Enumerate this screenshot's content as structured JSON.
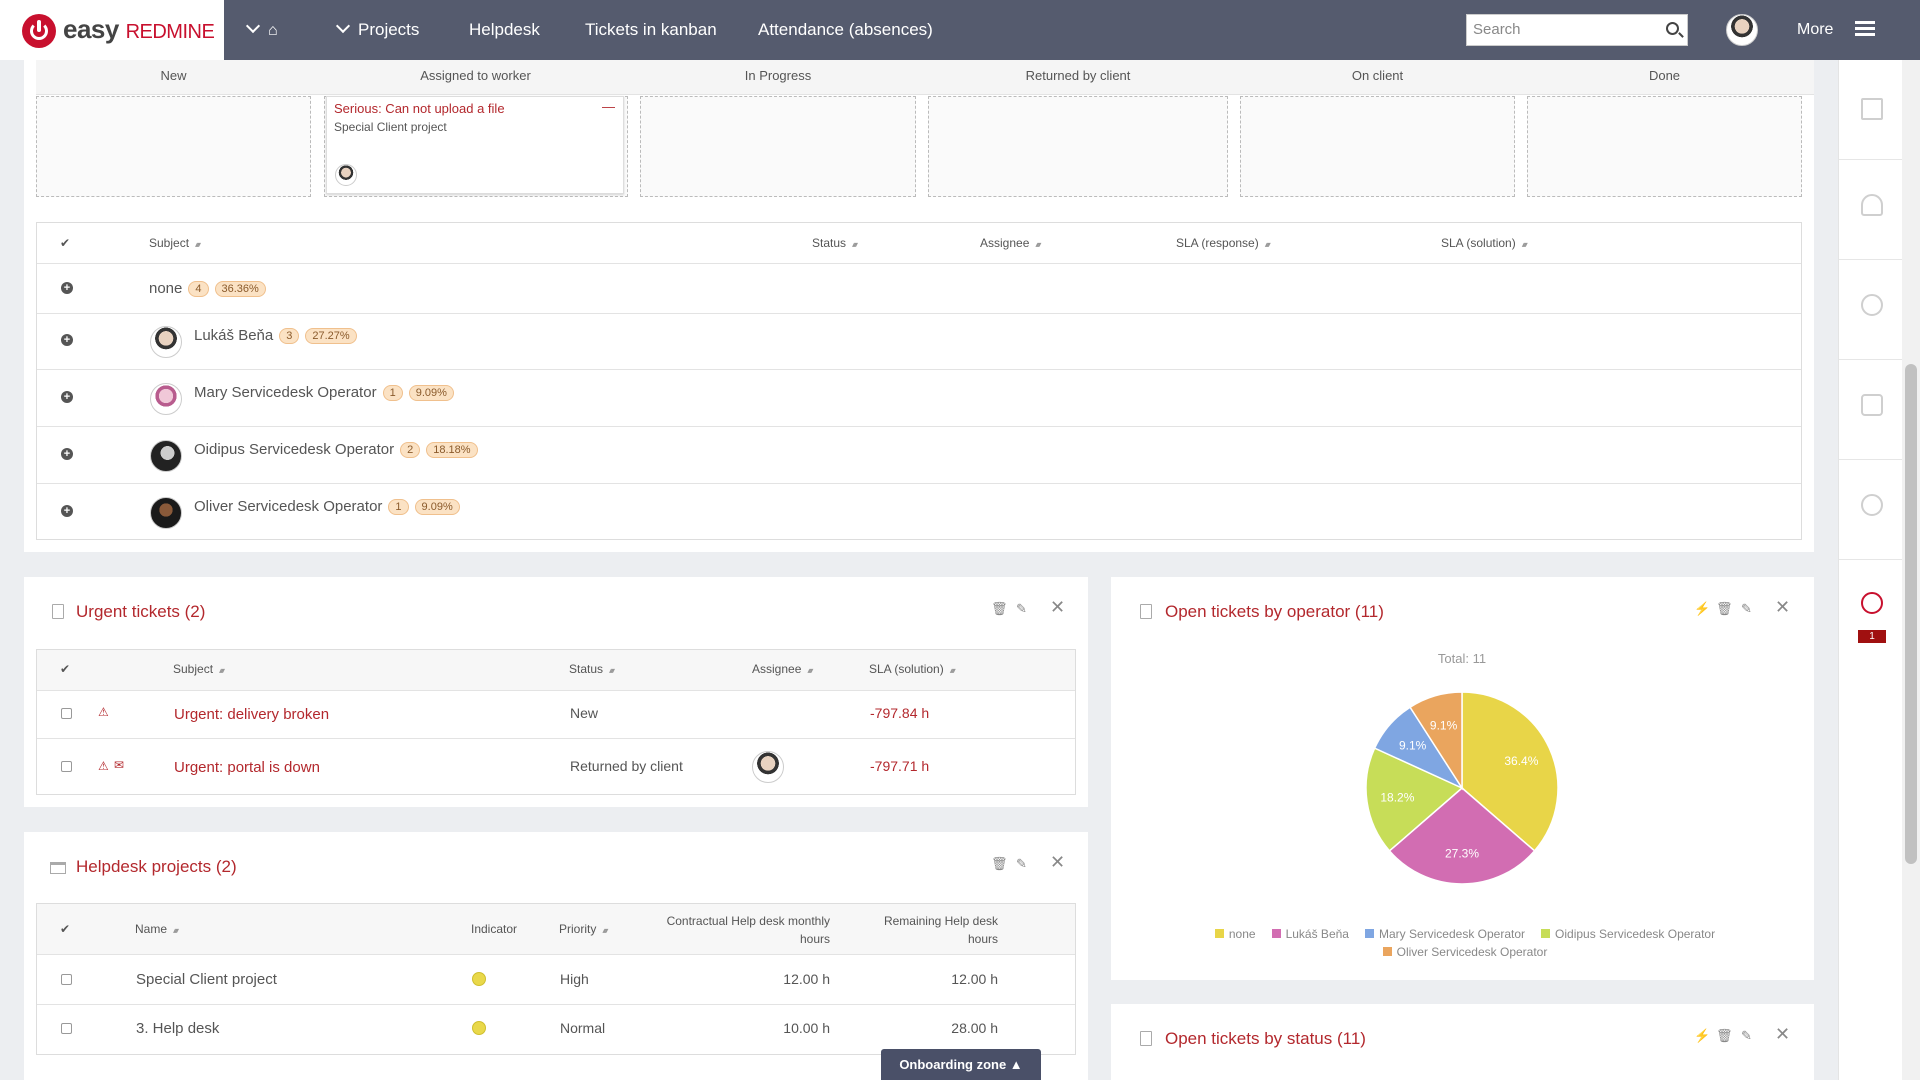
{
  "header": {
    "logo_brand": "easy",
    "logo_product": "REDMINE",
    "nav": [
      "Projects",
      "Helpdesk",
      "Tickets in kanban",
      "Attendance (absences)"
    ],
    "search_placeholder": "Search",
    "more": "More"
  },
  "kanban": {
    "columns": [
      "New",
      "Assigned to worker",
      "In Progress",
      "Returned by client",
      "On client",
      "Done"
    ],
    "card": {
      "title": "Serious: Can not upload a file",
      "project": "Special Client project",
      "collapse": "—"
    }
  },
  "grouped": {
    "headers": [
      "Subject",
      "Status",
      "Assignee",
      "SLA (response)",
      "SLA (solution)"
    ],
    "check": "✔",
    "groups": [
      {
        "label": "none",
        "count": "4",
        "pct": "36.36%"
      },
      {
        "label": "Lukáš Beňa",
        "count": "3",
        "pct": "27.27%"
      },
      {
        "label": "Mary Servicedesk Operator",
        "count": "1",
        "pct": "9.09%"
      },
      {
        "label": "Oidipus Servicedesk Operator",
        "count": "2",
        "pct": "18.18%"
      },
      {
        "label": "Oliver Servicedesk Operator",
        "count": "1",
        "pct": "9.09%"
      }
    ]
  },
  "urgent": {
    "title": "Urgent tickets (2)",
    "headers": [
      "Subject",
      "Status",
      "Assignee",
      "SLA (solution)"
    ],
    "rows": [
      {
        "subject": "Urgent: delivery broken",
        "status": "New",
        "sla": "-797.84 h"
      },
      {
        "subject": "Urgent: portal is down",
        "status": "Returned by client",
        "sla": "-797.71 h"
      }
    ]
  },
  "projects": {
    "title": "Helpdesk projects (2)",
    "headers": {
      "name": "Name",
      "indicator": "Indicator",
      "priority": "Priority",
      "contract_1": "Contractual Help desk monthly",
      "contract_2": "hours",
      "remaining_1": "Remaining Help desk",
      "remaining_2": "hours"
    },
    "rows": [
      {
        "name": "Special Client project",
        "priority": "High",
        "contract": "12.00 h",
        "remaining": "12.00 h"
      },
      {
        "name": "3. Help desk",
        "priority": "Normal",
        "contract": "10.00 h",
        "remaining": "28.00 h"
      }
    ]
  },
  "operator_chart": {
    "title": "Open tickets by operator (11)"
  },
  "status_chart": {
    "title": "Open tickets by status (11)"
  },
  "onboarding": "Onboarding zone ▲",
  "sidebar_badge": "1",
  "chart_data": {
    "type": "pie",
    "title": "Total: 11",
    "categories": [
      "none",
      "Lukáš Beňa",
      "Mary Servicedesk Operator",
      "Oidipus Servicedesk Operator",
      "Oliver Servicedesk Operator"
    ],
    "values": [
      36.4,
      27.3,
      9.1,
      18.2,
      9.1
    ],
    "value_labels": [
      "36.4%",
      "27.3%",
      "9.1%",
      "18.2%",
      "9.1%"
    ],
    "slice_order": [
      0,
      1,
      3,
      2,
      4
    ],
    "colors": [
      "#e8d548",
      "#d26db2",
      "#7fa6e2",
      "#c7dd58",
      "#eaa55e"
    ],
    "legend": "bottom"
  }
}
